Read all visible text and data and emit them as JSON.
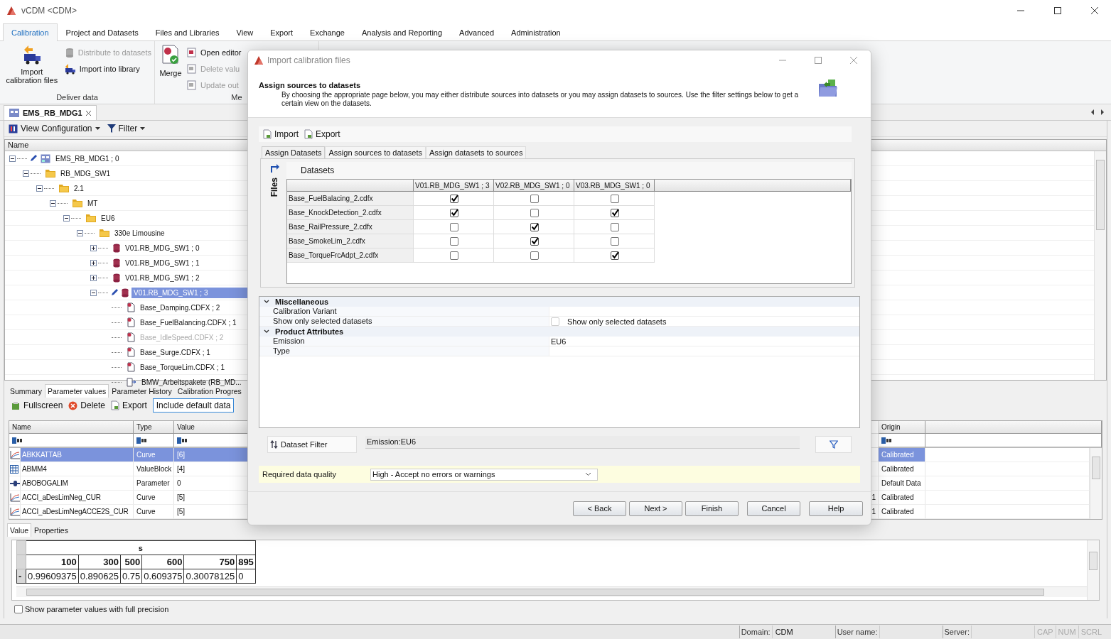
{
  "window": {
    "title": "vCDM <CDM>"
  },
  "ribbon": {
    "tabs": [
      {
        "label": "Calibration",
        "selected": true
      },
      {
        "label": "Project and Datasets",
        "selected": false
      },
      {
        "label": "Files and Libraries",
        "selected": false
      },
      {
        "label": "View",
        "selected": false
      },
      {
        "label": "Export",
        "selected": false
      },
      {
        "label": "Exchange",
        "selected": false
      },
      {
        "label": "Analysis and Reporting",
        "selected": false
      },
      {
        "label": "Advanced",
        "selected": false
      },
      {
        "label": "Administration",
        "selected": false
      }
    ],
    "deliver_group": {
      "label": "Deliver data",
      "import_button": "Import calibration files",
      "distribute_button": {
        "label": "Distribute to datasets",
        "disabled": true
      },
      "library_button": {
        "label": "Import into library",
        "disabled": false
      }
    },
    "merge_group": {
      "label": "Me",
      "merge_button": "Merge",
      "small_buttons": [
        {
          "label": "Open editor",
          "disabled": false
        },
        {
          "label": "Delete valu",
          "disabled": true
        },
        {
          "label": "Update out",
          "disabled": true
        }
      ]
    }
  },
  "document_tab": {
    "label": "EMS_RB_MDG1"
  },
  "toolbar": {
    "view_configuration": "View Configuration",
    "filter": "Filter"
  },
  "tree": {
    "column": "Name",
    "items": [
      {
        "label": "EMS_RB_MDG1 ; 0",
        "kind": "project",
        "expanded": true,
        "edited": true,
        "selected": false,
        "disabled": false,
        "children": [
          {
            "label": "RB_MDG_SW1",
            "kind": "folder",
            "expanded": true,
            "edited": false,
            "selected": false,
            "disabled": false,
            "children": [
              {
                "label": "2.1",
                "kind": "folder",
                "expanded": true,
                "edited": false,
                "selected": false,
                "disabled": false,
                "children": [
                  {
                    "label": "MT",
                    "kind": "folder",
                    "expanded": true,
                    "edited": false,
                    "selected": false,
                    "disabled": false,
                    "children": [
                      {
                        "label": "EU6",
                        "kind": "folder",
                        "expanded": true,
                        "edited": false,
                        "selected": false,
                        "disabled": false,
                        "children": [
                          {
                            "label": "330e Limousine",
                            "kind": "folder",
                            "expanded": true,
                            "edited": false,
                            "selected": false,
                            "disabled": false,
                            "children": [
                              {
                                "label": "V01.RB_MDG_SW1 ; 0",
                                "kind": "dataset",
                                "expanded": false,
                                "edited": false,
                                "selected": false,
                                "disabled": false
                              },
                              {
                                "label": "V01.RB_MDG_SW1 ; 1",
                                "kind": "dataset",
                                "expanded": false,
                                "edited": false,
                                "selected": false,
                                "disabled": false
                              },
                              {
                                "label": "V01.RB_MDG_SW1 ; 2",
                                "kind": "dataset",
                                "expanded": false,
                                "edited": false,
                                "selected": false,
                                "disabled": false
                              },
                              {
                                "label": "V01.RB_MDG_SW1 ; 3",
                                "kind": "dataset",
                                "expanded": true,
                                "edited": true,
                                "selected": true,
                                "disabled": false,
                                "children": [
                                  {
                                    "label": "Base_Damping.CDFX ; 2",
                                    "kind": "file",
                                    "edited": false,
                                    "selected": false,
                                    "disabled": false
                                  },
                                  {
                                    "label": "Base_FuelBalancing.CDFX ; 1",
                                    "kind": "file",
                                    "edited": false,
                                    "selected": false,
                                    "disabled": false
                                  },
                                  {
                                    "label": "Base_IdleSpeed.CDFX ; 2",
                                    "kind": "file",
                                    "edited": false,
                                    "selected": false,
                                    "disabled": true
                                  },
                                  {
                                    "label": "Base_Surge.CDFX ; 1",
                                    "kind": "file",
                                    "edited": false,
                                    "selected": false,
                                    "disabled": false
                                  },
                                  {
                                    "label": "Base_TorqueLim.CDFX ; 1",
                                    "kind": "file",
                                    "edited": false,
                                    "selected": false,
                                    "disabled": false
                                  },
                                  {
                                    "label": "BMW_Arbeitspakete (RB_MD...",
                                    "kind": "workpackage",
                                    "edited": false,
                                    "selected": false,
                                    "disabled": false
                                  }
                                ]
                              }
                            ]
                          }
                        ]
                      }
                    ]
                  }
                ]
              }
            ]
          }
        ]
      }
    ]
  },
  "detail_tabs": [
    {
      "label": "Summary",
      "selected": false
    },
    {
      "label": "Parameter values",
      "selected": true
    },
    {
      "label": "Parameter History",
      "selected": false
    },
    {
      "label": "Calibration Progres",
      "selected": false
    }
  ],
  "detail_toolbar": {
    "fullscreen": "Fullscreen",
    "delete": "Delete",
    "export": "Export",
    "include_default": "Include default data"
  },
  "parameters": {
    "columns": [
      "Name",
      "Type",
      "Value",
      "Origin"
    ],
    "rows": [
      {
        "kind": "curve",
        "name": "ABKKATTAB",
        "type": "Curve",
        "value": "[6]",
        "origin": "Calibrated",
        "selected": true
      },
      {
        "kind": "valueblock",
        "name": "ABMM4",
        "type": "ValueBlock",
        "value": "[4]",
        "origin": "Calibrated",
        "selected": false
      },
      {
        "kind": "parameter",
        "name": "ABOBOGALIM",
        "type": "Parameter",
        "value": "0",
        "origin": "Default Data",
        "selected": false
      },
      {
        "kind": "curve",
        "name": "ACCI_aDesLimNeg_CUR",
        "type": "Curve",
        "value": "[5]",
        "column_4": "1",
        "origin": "Calibrated",
        "selected": false
      },
      {
        "kind": "curve",
        "name": "ACCI_aDesLimNegACCE2S_CUR",
        "type": "Curve",
        "value": "[5]",
        "column_4": "1",
        "origin": "Calibrated",
        "selected": false
      }
    ]
  },
  "value_tabs": [
    {
      "label": "Value",
      "selected": true
    },
    {
      "label": "Properties",
      "selected": false
    }
  ],
  "value_table": {
    "axis_label": "s",
    "axis": [
      "100",
      "300",
      "500",
      "600",
      "750",
      "895"
    ],
    "row_label": "-",
    "values": [
      "0.99609375",
      "0.890625",
      "0.75",
      "0.609375",
      "0.30078125",
      "0"
    ]
  },
  "full_precision": {
    "label": "Show parameter values with full precision",
    "checked": false
  },
  "status_bar": {
    "fields": [
      {
        "label": "Domain:",
        "value": "CDM"
      },
      {
        "label": "User name:"
      },
      {
        "label": "Server:"
      }
    ],
    "indicators": [
      {
        "label": "CAP",
        "on": false
      },
      {
        "label": "NUM",
        "on": false
      },
      {
        "label": "SCRL",
        "on": false
      }
    ]
  },
  "dialog": {
    "title": "Import calibration files",
    "heading": "Assign sources to datasets",
    "description": "By choosing the appropriate page below, you may either distribute sources into datasets or you may assign datasets to sources. Use the filter settings below to get a certain view on the datasets.",
    "toolbar": [
      "Import",
      "Export"
    ],
    "tabs": [
      {
        "label": "Assign Datasets",
        "selected": true
      },
      {
        "label": "Assign sources to datasets",
        "selected": false
      },
      {
        "label": "Assign datasets to sources",
        "selected": false
      }
    ],
    "grid": {
      "title": "Datasets",
      "side_label": "Files",
      "columns": [
        "V01.RB_MDG_SW1 ; 3",
        "V02.RB_MDG_SW1 ; 0",
        "V03.RB_MDG_SW1 ; 0"
      ],
      "rows": [
        {
          "file": "Base_FuelBalacing_2.cdfx",
          "checks": [
            true,
            false,
            false
          ]
        },
        {
          "file": "Base_KnockDetection_2.cdfx",
          "checks": [
            true,
            false,
            true
          ]
        },
        {
          "file": "Base_RailPressure_2.cdfx",
          "checks": [
            false,
            true,
            false
          ]
        },
        {
          "file": "Base_SmokeLim_2.cdfx",
          "checks": [
            false,
            true,
            false
          ]
        },
        {
          "file": "Base_TorqueFrcAdpt_2.cdfx",
          "checks": [
            false,
            false,
            true
          ]
        }
      ]
    },
    "properties": [
      {
        "label": "Miscellaneous",
        "expanded": true,
        "rows": [
          {
            "label": "Calibration Variant",
            "kind": "text"
          },
          {
            "label": "Show only selected datasets",
            "kind": "checkbox",
            "checked": false,
            "caption": "Show only selected datasets"
          }
        ]
      },
      {
        "label": "Product Attributes",
        "expanded": true,
        "rows": [
          {
            "label": "Emission",
            "kind": "text",
            "value": "EU6"
          },
          {
            "label": "Type",
            "kind": "text"
          }
        ]
      }
    ],
    "filter_button": "Dataset Filter",
    "filter_value": "Emission:EU6",
    "quality": {
      "label": "Required data quality",
      "value": "High - Accept no errors or warnings"
    },
    "buttons": [
      "< Back",
      "Next >",
      "Finish",
      "Cancel",
      "Help"
    ]
  }
}
